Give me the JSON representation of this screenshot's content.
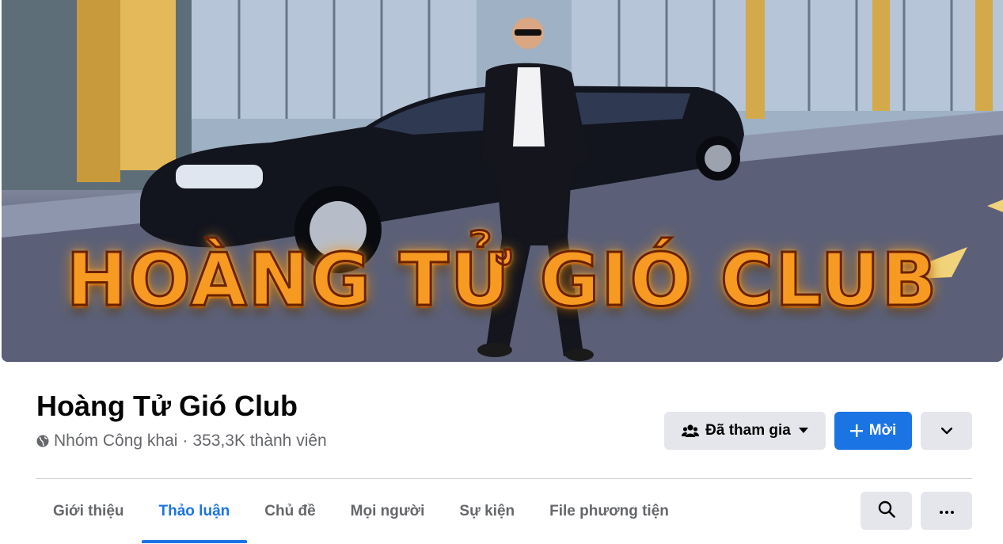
{
  "cover": {
    "overlay_title": "HOÀNG TỬ GIÓ CLUB",
    "title_color": "#f79a22"
  },
  "group": {
    "name": "Hoàng Tử Gió Club",
    "privacy": "Nhóm Công khai",
    "separator": "·",
    "members": "353,3K thành viên",
    "privacy_icon": "globe-icon"
  },
  "actions": {
    "joined_label": "Đã tham gia",
    "joined_icon": "people-icon",
    "invite_label": "Mời",
    "invite_icon": "plus-icon",
    "more_icon": "chevron-down-icon"
  },
  "tabs": [
    {
      "label": "Giới thiệu",
      "active": false
    },
    {
      "label": "Thảo luận",
      "active": true
    },
    {
      "label": "Chủ đề",
      "active": false
    },
    {
      "label": "Mọi người",
      "active": false
    },
    {
      "label": "Sự kiện",
      "active": false
    },
    {
      "label": "File phương tiện",
      "active": false
    }
  ],
  "tools": {
    "search_icon": "search-icon",
    "more_icon": "ellipsis-icon"
  },
  "colors": {
    "accent": "#1b74e4",
    "button_gray": "#e4e6eb",
    "secondary_text": "#65676b"
  }
}
